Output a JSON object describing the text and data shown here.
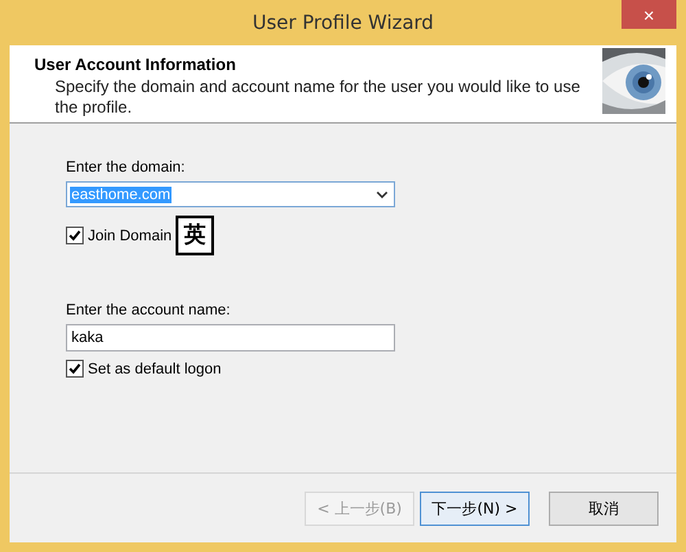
{
  "window": {
    "title": "User Profile Wizard",
    "close": "×"
  },
  "header": {
    "title": "User Account Information",
    "description": "Specify the domain and account name for the user you would like to use the profile."
  },
  "domain": {
    "label": "Enter the domain:",
    "value": "easthome.com",
    "selected_text": true
  },
  "join_domain": {
    "label": "Join Domain",
    "checked": true
  },
  "ime_indicator": "英",
  "account": {
    "label": "Enter the account name:",
    "value": "kaka"
  },
  "default_logon": {
    "label": "Set as default logon",
    "checked": true
  },
  "buttons": [
    {
      "label": "< 上一步(B)",
      "disabled": true,
      "focused": false
    },
    {
      "label": "下一步(N) >",
      "disabled": false,
      "focused": true
    },
    {
      "label": "取消",
      "disabled": false,
      "focused": false
    }
  ]
}
